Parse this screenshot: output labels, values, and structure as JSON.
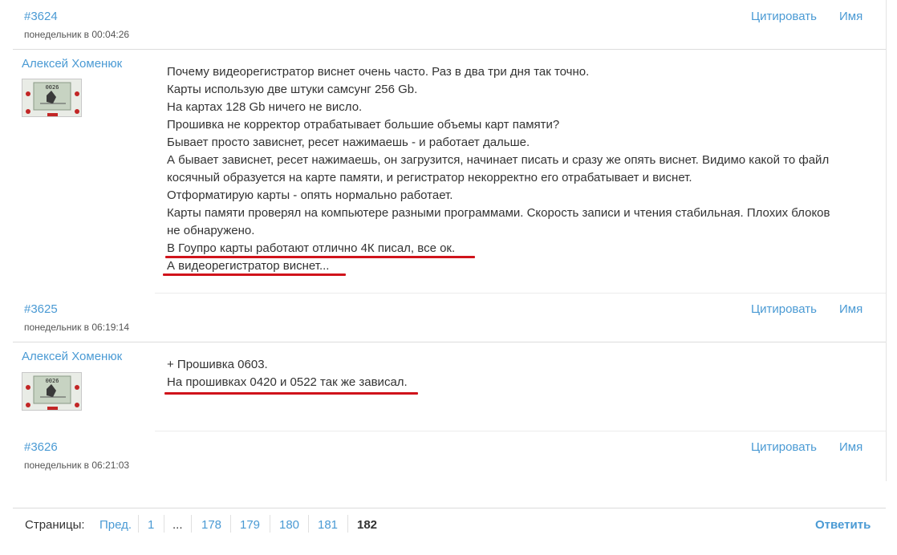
{
  "actions": {
    "quote": "Цитировать",
    "name": "Имя"
  },
  "posts": [
    {
      "number": "#3624",
      "date": "понедельник в 00:04:26"
    },
    {
      "number": "#3625",
      "date": "понедельник в 06:19:14",
      "author": "Алексей Хоменюк",
      "lines": [
        "Почему видеорегистратор виснет очень часто. Раз в два три дня так точно.",
        "Карты использую две штуки самсунг 256 Gb.",
        "На картах 128 Gb ничего не висло.",
        "Прошивка не корректор отрабатывает большие объемы карт памяти?",
        "Бывает просто зависнет, ресет нажимаешь - и работает дальше.",
        "А бывает зависнет, ресет нажимаешь, он загрузится, начинает писать и сразу же опять виснет. Видимо какой то файл",
        "косячный образуется на карте памяти, и регистратор некорректно его отрабатывает и виснет.",
        "Отформатирую карты - опять нормально работает.",
        "Карты памяти проверял на компьютере разными программами. Скорость записи и чтения стабильная. Плохих блоков",
        "не обнаружено.",
        "В Гоупро карты работают отлично 4К писал, все ок.",
        "А видеорегистратор виснет..."
      ]
    },
    {
      "number": "#3626",
      "date": "понедельник в 06:21:03",
      "author": "Алексей Хоменюк",
      "lines": [
        "+ Прошивка 0603.",
        "На прошивках 0420 и 0522 так же зависал."
      ]
    }
  ],
  "avatar": {
    "display_number": "0026"
  },
  "pagination": {
    "label": "Страницы:",
    "prev": "Пред.",
    "pages": [
      "1",
      "...",
      "178",
      "179",
      "180",
      "181"
    ],
    "current": "182"
  },
  "reply_label": "Ответить",
  "colors": {
    "link": "#4a9ad4",
    "underline": "#d0131b"
  }
}
